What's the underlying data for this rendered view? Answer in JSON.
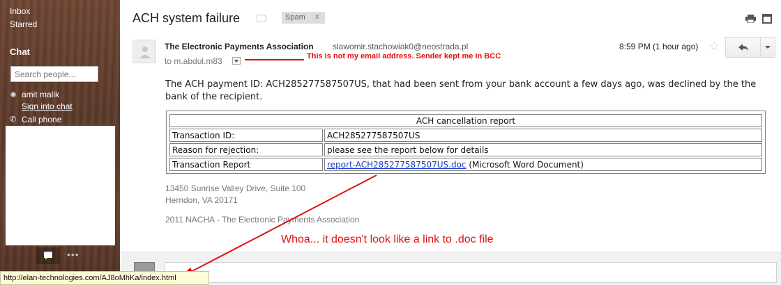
{
  "sidebar": {
    "nav": [
      "Inbox",
      "Starred"
    ],
    "chat_heading": "Chat",
    "search_placeholder": "Search people...",
    "user_name": "amit malik",
    "sign_in_label": "Sign into chat",
    "call_phone_label": "Call phone"
  },
  "email": {
    "subject": "ACH system failure",
    "label_chip": "Spam",
    "label_chip_close": "x",
    "sender_name": "The Electronic Payments Association",
    "sender_email": "slawomir.stachowiak0@neostrada.pl",
    "recipient": "to m.abdul.m83",
    "time": "8:59 PM (1 hour ago)",
    "body_text": "The ACH payment ID: ACH285277587507US, that had been sent from your bank account a few days ago, was declined by the the bank of the recipient.",
    "report": {
      "title": "ACH cancellation report",
      "rows": [
        {
          "label": "Transaction ID:",
          "value": "ACH285277587507US"
        },
        {
          "label": "Reason for rejection:",
          "value": "please see the report below for details"
        }
      ],
      "link_row_label": "Transaction Report",
      "link_text": "report-ACH285277587507US.doc",
      "link_suffix": " (Microsoft Word Document)"
    },
    "address_line1": "13450 Sunrise Valley Drive, Suite 100",
    "address_line2": "Herndon, VA 20171",
    "copyright": "2011 NACHA - The Electronic Payments Association"
  },
  "annotations": {
    "bcc_note": "This is not my email address. Sender kept me in BCC",
    "link_note": "Whoa... it doesn't look like a link to .doc file",
    "color": "#e01010"
  },
  "status_bar": {
    "url": "http://elan-technologies.com/AJ8oMhKa/index.html"
  },
  "colors": {
    "link": "#1a3bc1",
    "status_bar_bg": "#fffbd6"
  },
  "icons": {
    "label": "label-tag-icon",
    "print": "print-icon",
    "popout": "new-window-icon",
    "star": "star-icon",
    "reply": "reply-arrow-icon",
    "more": "chevron-down-icon",
    "phone": "phone-icon",
    "chat_bubble": "chat-bubble-icon",
    "more_dots": "more-dots-icon",
    "status_dot": "presence-dot-icon"
  }
}
